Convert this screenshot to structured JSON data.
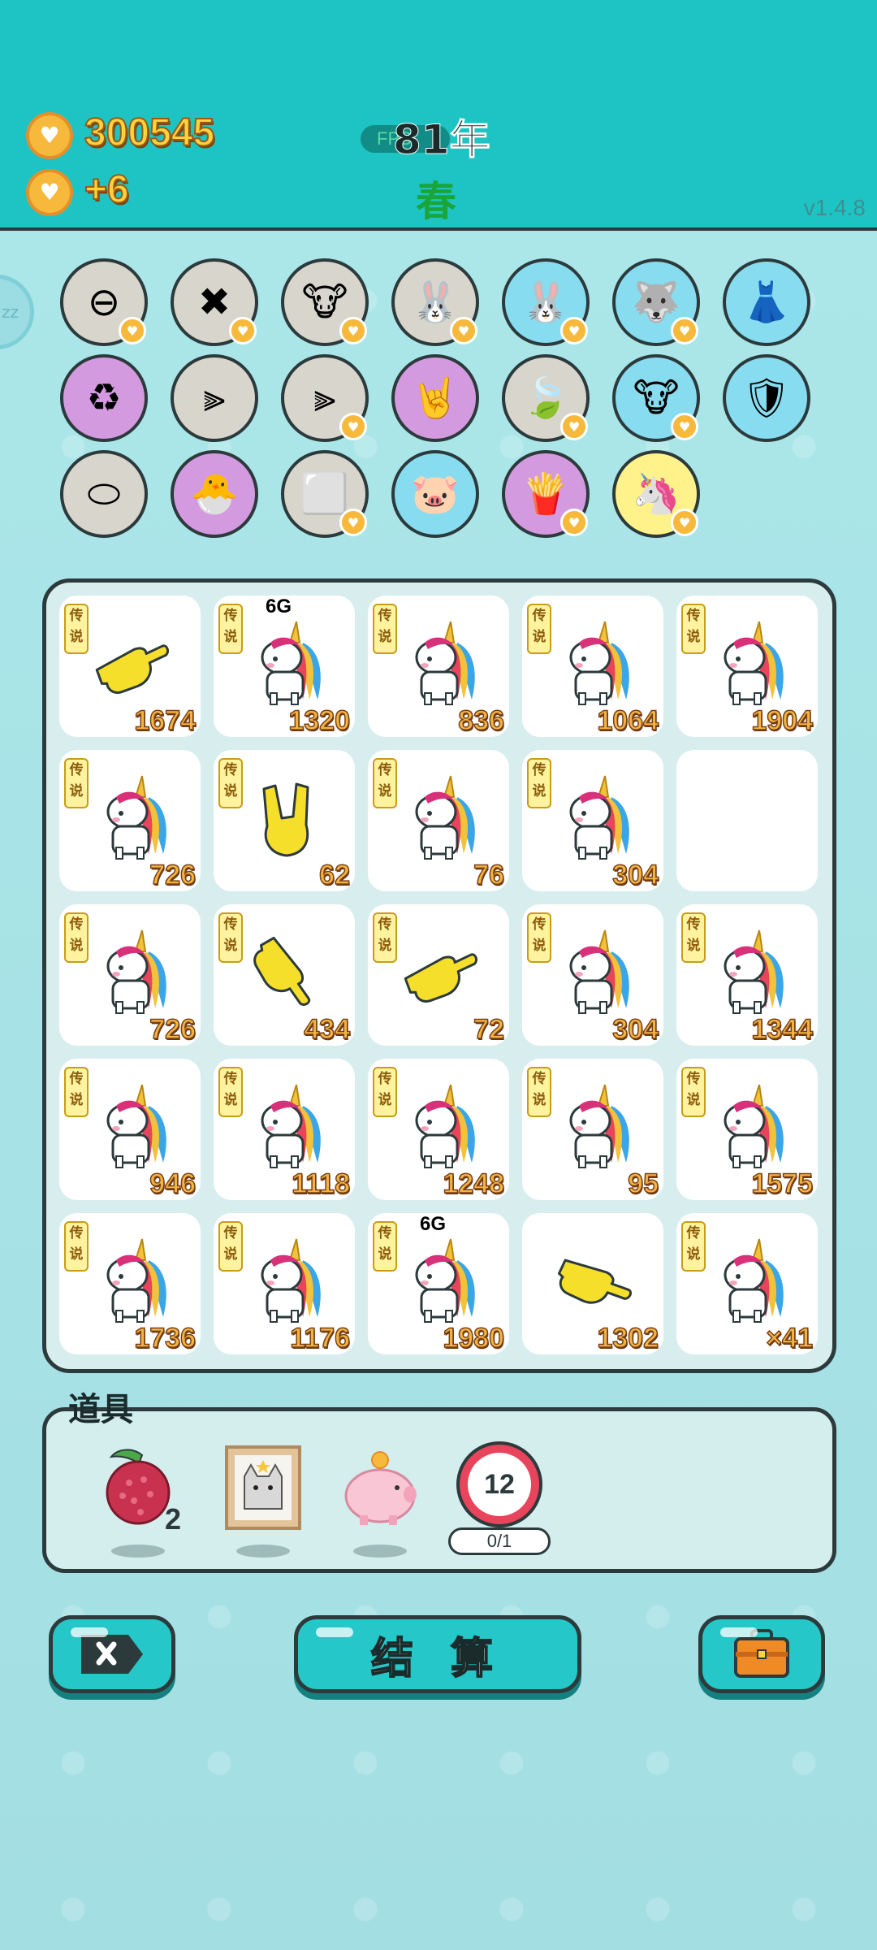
{
  "header": {
    "coins": "300545",
    "income": "+6",
    "fps": "FPS",
    "year": "81年",
    "season": "春",
    "version": "v1.4.8",
    "side_tab": "zz"
  },
  "skills": [
    {
      "icon": "minus-circle-icon",
      "glyph": "⊖",
      "bg": "grey",
      "badge": true
    },
    {
      "icon": "delete-tag-icon",
      "glyph": "✖",
      "bg": "grey",
      "badge": true
    },
    {
      "icon": "cow-pair-icon",
      "glyph": "🐮",
      "bg": "grey",
      "badge": true
    },
    {
      "icon": "rabbit-icon",
      "glyph": "🐰",
      "bg": "grey",
      "badge": true
    },
    {
      "icon": "rabbit-icon",
      "glyph": "🐰",
      "bg": "blue",
      "badge": true
    },
    {
      "icon": "husky-icon",
      "glyph": "🐺",
      "bg": "blue",
      "badge": true
    },
    {
      "icon": "skirt-icon",
      "glyph": "👗",
      "bg": "blue",
      "badge": false
    },
    {
      "icon": "recycle-icon",
      "glyph": "♻",
      "bg": "purple",
      "badge": false
    },
    {
      "icon": "skip-bar-icon",
      "glyph": "⫸",
      "bg": "grey",
      "badge": false
    },
    {
      "icon": "skip-bar-icon",
      "glyph": "⫸",
      "bg": "grey",
      "badge": true
    },
    {
      "icon": "rock-hand-icon",
      "glyph": "🤘",
      "bg": "purple",
      "badge": false
    },
    {
      "icon": "leaf-icon",
      "glyph": "🍃",
      "bg": "grey",
      "badge": true
    },
    {
      "icon": "cow-pair-icon",
      "glyph": "🐮",
      "bg": "blue",
      "badge": true
    },
    {
      "icon": "shield-wrench-icon",
      "glyph": "🛡",
      "bg": "blue",
      "badge": false
    },
    {
      "icon": "egg-tray-icon",
      "glyph": "⬭",
      "bg": "grey",
      "badge": false
    },
    {
      "icon": "chick-egg-icon",
      "glyph": "🐣",
      "bg": "purple",
      "badge": false
    },
    {
      "icon": "sugar-cubes-icon",
      "glyph": "⬜",
      "bg": "grey",
      "badge": true
    },
    {
      "icon": "piggy-bank-icon",
      "glyph": "🐷",
      "bg": "blue",
      "badge": false
    },
    {
      "icon": "fries-icon",
      "glyph": "🍟",
      "bg": "purple",
      "badge": true
    },
    {
      "icon": "unicorn-icon",
      "glyph": "🦄",
      "bg": "yellow",
      "badge": true
    }
  ],
  "board": {
    "legend_tag": "传说",
    "cells": [
      {
        "kind": "point-hand",
        "value": "1674",
        "net": "",
        "tag": true
      },
      {
        "kind": "unicorn",
        "value": "1320",
        "net": "6G",
        "tag": true
      },
      {
        "kind": "unicorn",
        "value": "836",
        "net": "",
        "tag": true
      },
      {
        "kind": "unicorn",
        "value": "1064",
        "net": "",
        "tag": true
      },
      {
        "kind": "unicorn",
        "value": "1904",
        "net": "",
        "tag": true
      },
      {
        "kind": "unicorn",
        "value": "726",
        "net": "",
        "tag": true
      },
      {
        "kind": "rock-hand",
        "value": "62",
        "net": "",
        "tag": true
      },
      {
        "kind": "unicorn",
        "value": "76",
        "net": "",
        "tag": true
      },
      {
        "kind": "unicorn",
        "value": "304",
        "net": "",
        "tag": true
      },
      {
        "kind": "empty",
        "value": "",
        "net": "",
        "tag": false
      },
      {
        "kind": "unicorn",
        "value": "726",
        "net": "",
        "tag": true
      },
      {
        "kind": "down-hand",
        "value": "434",
        "net": "",
        "tag": true
      },
      {
        "kind": "point-hand",
        "value": "72",
        "net": "",
        "tag": true
      },
      {
        "kind": "unicorn",
        "value": "304",
        "net": "",
        "tag": true
      },
      {
        "kind": "unicorn",
        "value": "1344",
        "net": "",
        "tag": true
      },
      {
        "kind": "unicorn",
        "value": "946",
        "net": "",
        "tag": true
      },
      {
        "kind": "unicorn",
        "value": "1118",
        "net": "",
        "tag": true
      },
      {
        "kind": "unicorn",
        "value": "1248",
        "net": "",
        "tag": true
      },
      {
        "kind": "unicorn",
        "value": "95",
        "net": "",
        "tag": true
      },
      {
        "kind": "unicorn",
        "value": "1575",
        "net": "",
        "tag": true
      },
      {
        "kind": "unicorn",
        "value": "1736",
        "net": "",
        "tag": true
      },
      {
        "kind": "unicorn",
        "value": "1176",
        "net": "",
        "tag": true
      },
      {
        "kind": "unicorn",
        "value": "1980",
        "net": "6G",
        "tag": true
      },
      {
        "kind": "point-hand-right",
        "value": "1302",
        "net": "",
        "tag": false
      },
      {
        "kind": "unicorn",
        "value": "×41",
        "net": "",
        "tag": true
      }
    ]
  },
  "items": {
    "title": "道具",
    "lychee_count": "2",
    "timer_value": "12",
    "timer_progress": "0/1"
  },
  "buttons": {
    "settle_label": "结 算"
  }
}
